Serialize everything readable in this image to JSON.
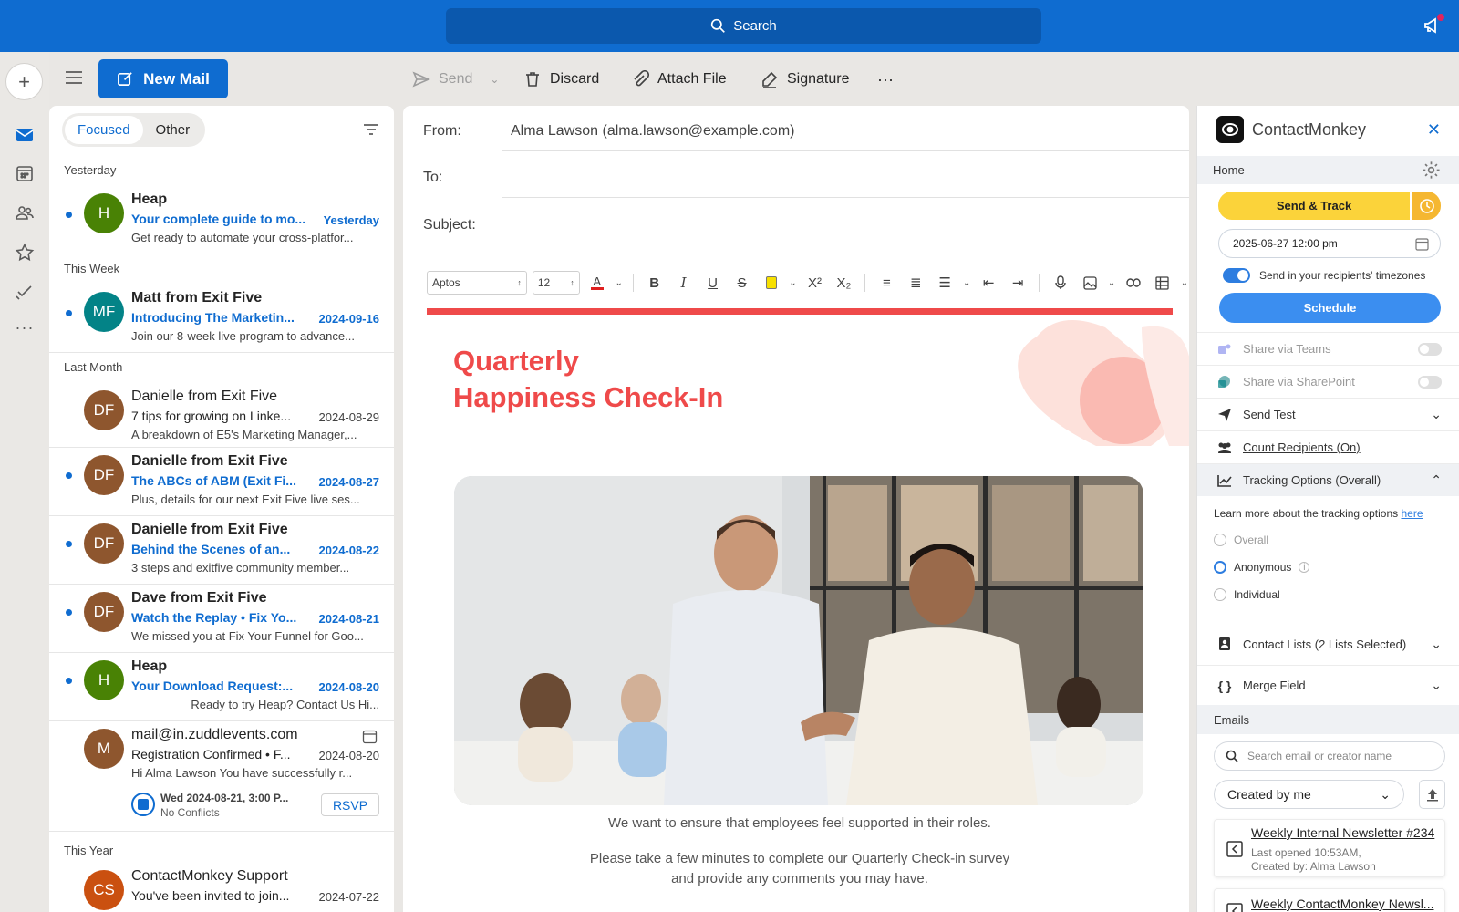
{
  "topbar": {
    "search_label": "Search"
  },
  "toolbar": {
    "new_mail": "New Mail",
    "send": "Send",
    "discard": "Discard",
    "attach": "Attach File",
    "signature": "Signature",
    "more": "···"
  },
  "list": {
    "tabs": [
      "Focused",
      "Other"
    ],
    "groups": [
      "Yesterday",
      "This Week",
      "Last Month",
      "This Year"
    ],
    "items": [
      {
        "initials": "H",
        "color": "#498205",
        "sender": "Heap",
        "subject": "Your complete guide to mo...",
        "date": "Yesterday",
        "preview": "Get ready to automate your cross-platfor...",
        "unread": true
      },
      {
        "initials": "MF",
        "color": "#038387",
        "sender": "Matt from Exit Five",
        "subject": "Introducing The Marketin...",
        "date": "2024-09-16",
        "preview": "Join our 8-week live program to advance...",
        "unread": true
      },
      {
        "initials": "DF",
        "color": "#8e562e",
        "sender": "Danielle from Exit Five",
        "subject": "7 tips for growing on Linke...",
        "date": "2024-08-29",
        "preview": "A breakdown of E5's Marketing Manager,...",
        "unread": false
      },
      {
        "initials": "DF",
        "color": "#8e562e",
        "sender": "Danielle from Exit Five",
        "subject": "The ABCs of ABM (Exit Fi...",
        "date": "2024-08-27",
        "preview": "Plus, details for our next Exit Five live ses...",
        "unread": true
      },
      {
        "initials": "DF",
        "color": "#8e562e",
        "sender": "Danielle from Exit Five",
        "subject": "Behind the Scenes of an...",
        "date": "2024-08-22",
        "preview": "3 steps and exitfive community member...",
        "unread": true
      },
      {
        "initials": "DF",
        "color": "#8e562e",
        "sender": "Dave from Exit Five",
        "subject": "Watch the Replay • Fix Yo...",
        "date": "2024-08-21",
        "preview": "We missed you at Fix Your Funnel for Goo...",
        "unread": true
      },
      {
        "initials": "H",
        "color": "#498205",
        "sender": "Heap",
        "subject": "Your Download Request:...",
        "date": "2024-08-20",
        "preview": "Ready to try Heap? Contact Us Hi...",
        "unread": true
      },
      {
        "initials": "M",
        "color": "#8e562e",
        "sender": "mail@in.zuddlevents.com",
        "subject": "Registration Confirmed • F...",
        "date": "2024-08-20",
        "preview": "Hi Alma Lawson   You have successfully r...",
        "unread": false,
        "event_time": "Wed 2024-08-21, 3:00 P...",
        "event_status": "No Conflicts",
        "rsvp": "RSVP"
      },
      {
        "initials": "CS",
        "color": "#ca5010",
        "sender": "ContactMonkey Support",
        "subject": "You've been invited to join...",
        "date": "2024-07-22",
        "preview": "",
        "unread": false
      }
    ]
  },
  "compose": {
    "from_label": "From:",
    "from_value": "Alma Lawson (alma.lawson@example.com)",
    "to_label": "To:",
    "subject_label": "Subject:",
    "font_name": "Aptos",
    "font_size": "12",
    "title_line1": "Quarterly",
    "title_line2": "Happiness Check-In",
    "body_1": "We want to ensure that employees feel supported in their roles.",
    "body_2": "Please take a few minutes to complete our Quarterly Check-in survey",
    "body_3": "and provide any comments you may have.",
    "accent": "#ef4a4a"
  },
  "cm": {
    "brand": "ContactMonkey",
    "home": "Home",
    "send_track": "Send & Track",
    "datetime": "2025-06-27 12:00 pm",
    "timezone_label": "Send in your recipients' timezones",
    "schedule": "Schedule",
    "share_teams": "Share via Teams",
    "share_sharepoint": "Share via SharePoint",
    "send_test": "Send Test",
    "count_recipients": "Count Recipients (On)",
    "tracking_options": "Tracking Options (Overall)",
    "tracking_learn": "Learn more about the tracking options",
    "tracking_here": "here",
    "opt_overall": "Overall",
    "opt_anonymous": "Anonymous",
    "opt_individual": "Individual",
    "contact_lists": "Contact Lists (2 Lists Selected)",
    "merge_field": "Merge Field",
    "emails": "Emails",
    "search_placeholder": "Search email or creator name",
    "created_by": "Created by me",
    "newsletter_1_title": "Weekly Internal Newsletter #234",
    "newsletter_1_meta1": "Last opened 10:53AM,",
    "newsletter_1_meta2": "Created by: Alma Lawson",
    "newsletter_2_title": "Weekly ContactMonkey Newsl..."
  }
}
